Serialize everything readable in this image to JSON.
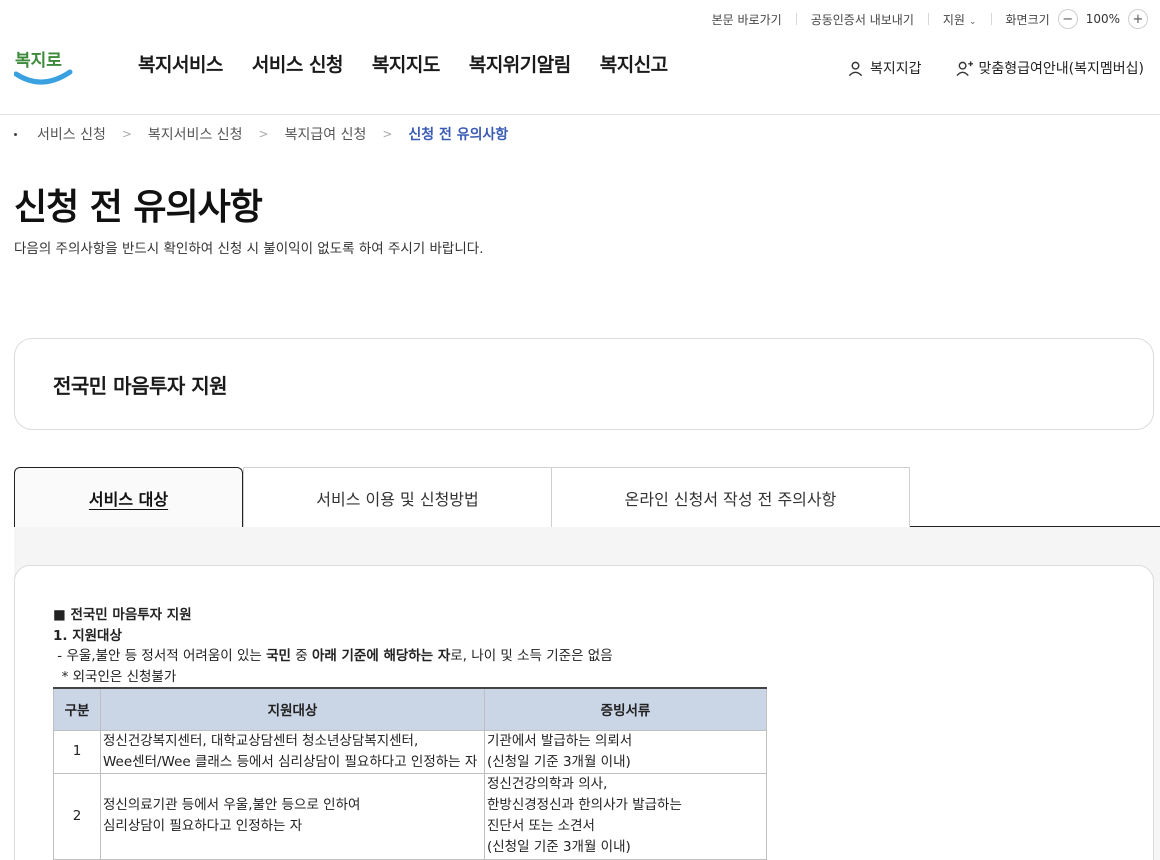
{
  "utility": {
    "skip_link": "본문 바로가기",
    "cert_export": "공동인증서 내보내기",
    "support": "지원",
    "screen_size": "화면크기",
    "zoom_minus": "−",
    "zoom_value": "100%",
    "zoom_plus": "+"
  },
  "logo": {
    "text": "복지로"
  },
  "nav": {
    "items": [
      "복지서비스",
      "서비스 신청",
      "복지지도",
      "복지위기알림",
      "복지신고"
    ]
  },
  "header_right": {
    "wallet": "복지지갑",
    "membership": "맞춤형급여안내(복지멤버십)"
  },
  "breadcrumb": {
    "items": [
      "서비스 신청",
      "복지서비스 신청",
      "복지급여 신청"
    ],
    "current": "신청 전 유의사항"
  },
  "page": {
    "title": "신청 전 유의사항",
    "description": "다음의 주의사항을 반드시 확인하여 신청 시 불이익이 없도록 하여 주시기 바랍니다."
  },
  "service": {
    "name": "전국민 마음투자 지원"
  },
  "tabs": [
    {
      "label": "서비스 대상",
      "active": true
    },
    {
      "label": "서비스 이용 및 신청방법",
      "active": false
    },
    {
      "label": "온라인 신청서 작성 전 주의사항",
      "active": false
    }
  ],
  "content": {
    "heading": "■ 전국민 마음투자 지원",
    "section": "1. 지원대상",
    "line_prefix": " - 우울,불안 등 정서적 어려움이 있는 ",
    "line_bold1": "국민",
    "line_mid": " 중 ",
    "line_bold2": "아래 기준에 해당하는 자",
    "line_suffix": "로, 나이 및 소득 기준은 없음",
    "note": "  * 외국인은 신청불가",
    "table": {
      "headers": [
        "구분",
        "지원대상",
        "증빙서류"
      ],
      "rows": [
        {
          "no": "1",
          "target": [
            "정신건강복지센터, 대학교상담센터 청소년상담복지센터,",
            "Wee센터/Wee 클래스 등에서 심리상담이 필요하다고 인정하는 자"
          ],
          "docs": [
            "기관에서 발급하는 의뢰서",
            "(신청일 기준 3개월 이내)"
          ]
        },
        {
          "no": "2",
          "target": [
            "정신의료기관 등에서 우울,불안 등으로 인하여",
            "심리상담이 필요하다고 인정하는 자"
          ],
          "docs": [
            "정신건강의학과 의사,",
            "한방신경정신과 한의사가 발급하는",
            "진단서 또는 소견서",
            "(신청일 기준 3개월 이내)"
          ]
        }
      ]
    }
  }
}
